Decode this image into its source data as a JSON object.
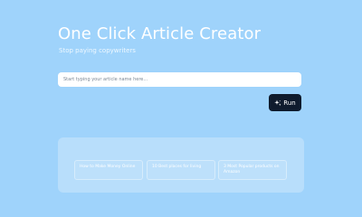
{
  "header": {
    "title": "One Click Article Creator",
    "subtitle": "Stop paying copywriters"
  },
  "search": {
    "placeholder": "Start typing your article name here..."
  },
  "run_button": {
    "label": "Run",
    "icon": "sparkle-icon"
  },
  "suggestions": [
    {
      "label": "How to Make Money Online"
    },
    {
      "label": "10 Best places for living"
    },
    {
      "label": "3 Most Popular products on Amazon"
    }
  ],
  "colors": {
    "background": "#9fd3fb",
    "panel": "#b8defb",
    "button": "#0f1b2d",
    "text_light": "#ffffff"
  }
}
